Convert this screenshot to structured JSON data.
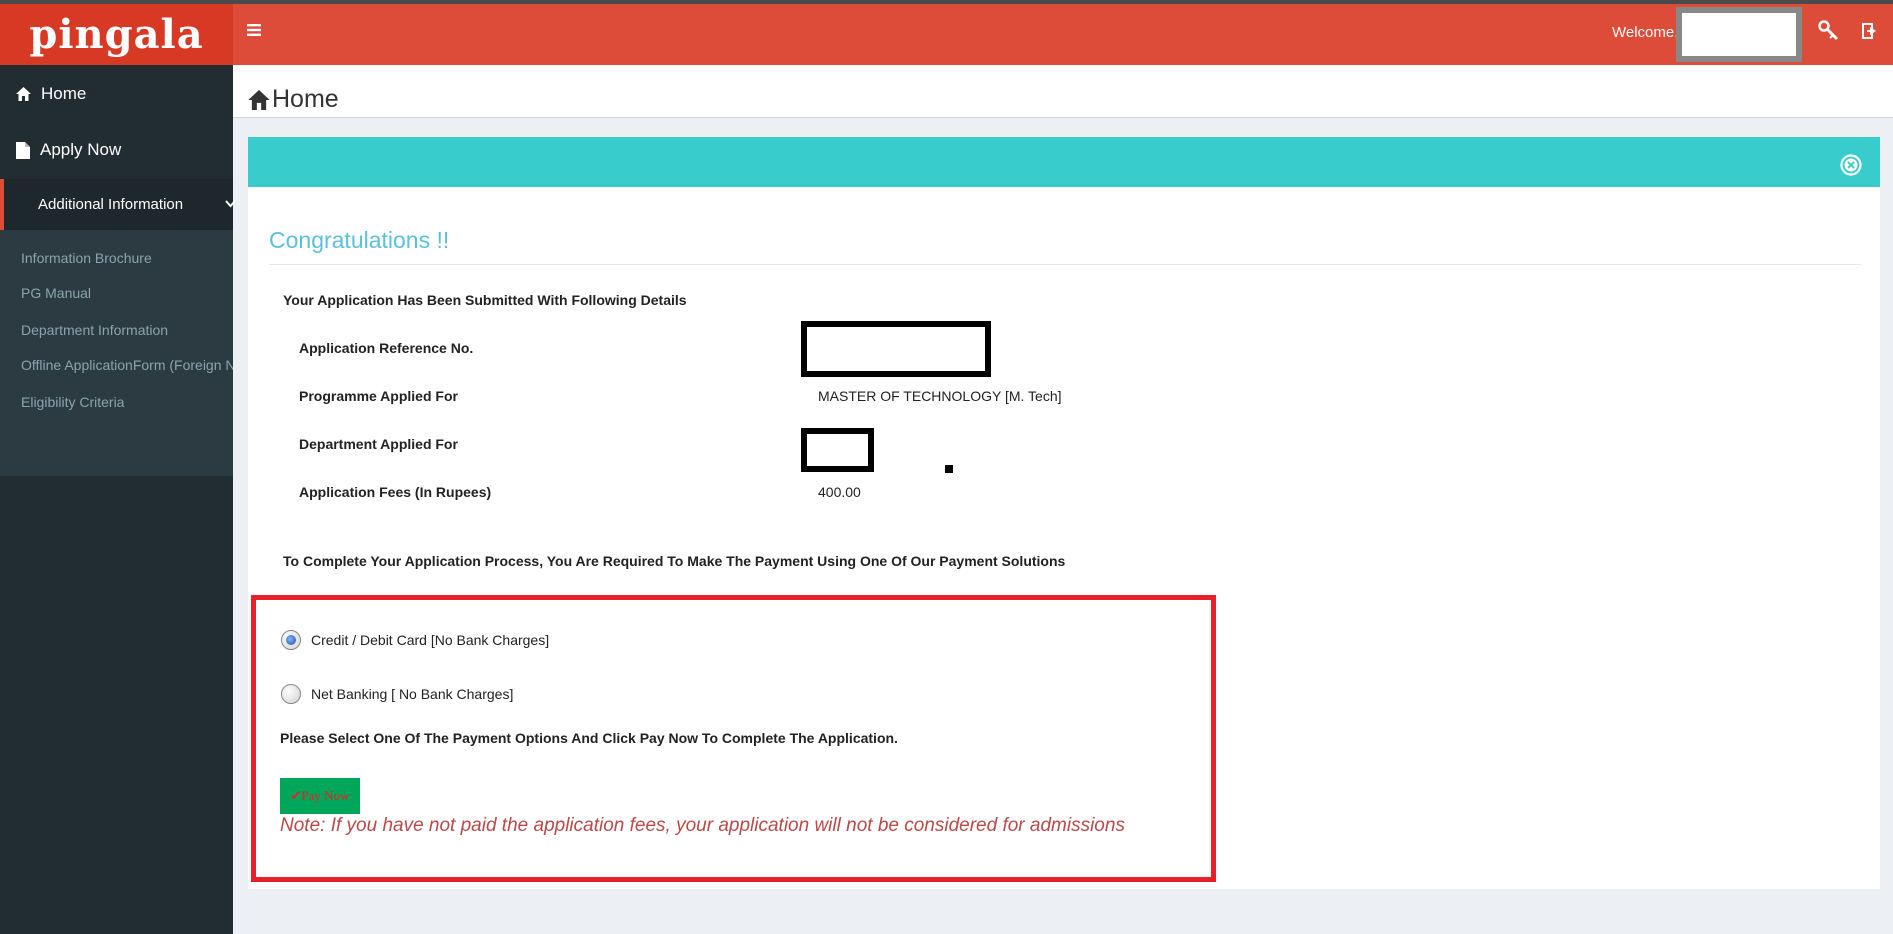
{
  "header": {
    "logo": "pingala",
    "menu_icon": "hamburger-icon",
    "welcome": "Welcome,",
    "icons": [
      "key-icon",
      "logout-icon"
    ]
  },
  "sidebar": {
    "items": [
      {
        "label": "Home",
        "icon": "home-icon"
      },
      {
        "label": "Apply Now",
        "icon": "file-icon"
      },
      {
        "label": "Additional Information",
        "icon": "chevron-down-icon"
      }
    ],
    "submenu": [
      "Information Brochure",
      "PG Manual",
      "Department Information",
      "Offline ApplicationForm (Foreign Na",
      "Eligibility Criteria"
    ]
  },
  "page": {
    "title": "Home"
  },
  "box": {
    "close_icon": "close-circle-icon",
    "heading": "Congratulations !!",
    "subheading": "Your Application Has Been Submitted With Following Details",
    "details": [
      {
        "label": "Application Reference No.",
        "value": ""
      },
      {
        "label": "Programme Applied For",
        "value": "MASTER OF TECHNOLOGY [M. Tech]"
      },
      {
        "label": "Department Applied For",
        "value": ""
      },
      {
        "label": "Application Fees (In Rupees)",
        "value": "400.00"
      }
    ],
    "instruction": "To Complete Your Application Process, You Are Required To Make The Payment Using One Of Our Payment Solutions",
    "payment": {
      "options": [
        {
          "label": "Credit / Debit Card [No Bank Charges]",
          "selected": true
        },
        {
          "label": "Net Banking [ No Bank Charges]",
          "selected": false
        }
      ],
      "select_message": "Please Select One Of The Payment Options And Click Pay Now To Complete The Application.",
      "pay_button": "✔Pay Now",
      "note": "Note: If you have not paid the application fees, your application will not be considered for admissions"
    }
  },
  "colors": {
    "header": "#dd4b39",
    "sidebar": "#222d32",
    "box_header": "#39cccc",
    "pay_button": "#00a65a",
    "highlight": "#e8202a"
  }
}
